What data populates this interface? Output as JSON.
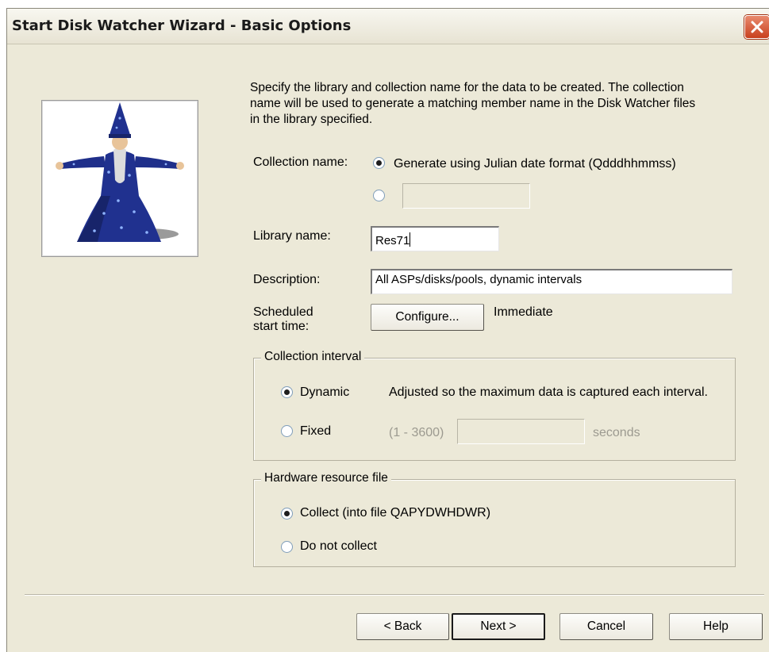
{
  "window": {
    "title": "Start Disk Watcher Wizard - Basic Options",
    "close_icon": "close-icon"
  },
  "wizard_image": "wizard-figure",
  "intro_text": "Specify the library and collection name for the data to be created.  The collection name will be used to generate a matching member name in the Disk Watcher files in the library specified.",
  "collection_name": {
    "label": "Collection name:",
    "options": [
      {
        "label": "Generate using Julian date format (Qdddhhmmss)",
        "selected": true
      },
      {
        "label": "",
        "selected": false
      }
    ],
    "custom_value": ""
  },
  "library_name": {
    "label": "Library name:",
    "value": "Res71"
  },
  "description": {
    "label": "Description:",
    "value": "All ASPs/disks/pools, dynamic intervals"
  },
  "scheduled_start": {
    "label_line1": "Scheduled",
    "label_line2": "start time:",
    "button_label": "Configure...",
    "value": "Immediate"
  },
  "collection_interval": {
    "legend": "Collection interval",
    "dynamic_label": "Dynamic",
    "dynamic_desc": "Adjusted so the maximum data is captured each interval.",
    "fixed_label": "Fixed",
    "range_hint": "(1 - 3600)",
    "fixed_value": "",
    "units": "seconds",
    "selected": "Dynamic"
  },
  "hardware_resource": {
    "legend": "Hardware resource file",
    "collect_label": "Collect (into file QAPYDWHDWR)",
    "not_collect_label": "Do not collect",
    "selected": "Collect"
  },
  "footer": {
    "back_label": "< Back",
    "next_label": "Next >",
    "cancel_label": "Cancel",
    "help_label": "Help"
  }
}
